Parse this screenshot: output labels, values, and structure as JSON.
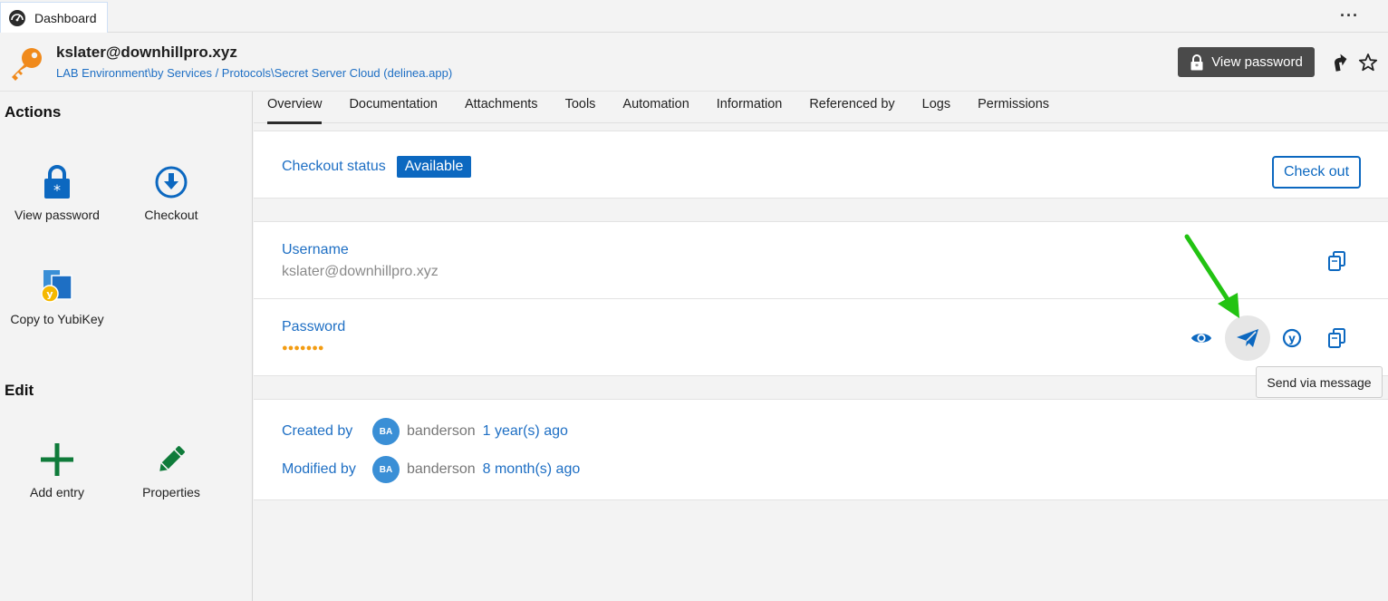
{
  "window": {
    "tab_label": "Dashboard",
    "more_icon": "more-horizontal-icon"
  },
  "header": {
    "title": "kslater@downhillpro.xyz",
    "path": "LAB Environment\\by Services / Protocols\\Secret Server Cloud (delinea.app)",
    "view_password_label": "View password",
    "key_color": "#f08a1c"
  },
  "sidebar": {
    "actions_title": "Actions",
    "edit_title": "Edit",
    "actions": [
      {
        "label": "View password",
        "icon": "lock-asterisk-icon"
      },
      {
        "label": "Checkout",
        "icon": "download-circle-icon"
      },
      {
        "label": "Copy to YubiKey",
        "icon": "yubikey-copy-icon"
      }
    ],
    "edit": [
      {
        "label": "Add entry",
        "icon": "plus-icon"
      },
      {
        "label": "Properties",
        "icon": "pencil-icon"
      }
    ]
  },
  "tabs": [
    "Overview",
    "Documentation",
    "Attachments",
    "Tools",
    "Automation",
    "Information",
    "Referenced by",
    "Logs",
    "Permissions"
  ],
  "active_tab": "Overview",
  "checkout": {
    "label": "Checkout status",
    "status": "Available",
    "button": "Check out"
  },
  "fields": {
    "username_label": "Username",
    "username_value": "kslater@downhillpro.xyz",
    "password_label": "Password",
    "password_mask": "●●●●●●●"
  },
  "tooltip": "Send via message",
  "meta": {
    "created_label": "Created by",
    "created_initials": "BA",
    "created_user": "banderson",
    "created_when": "1 year(s) ago",
    "modified_label": "Modified by",
    "modified_initials": "BA",
    "modified_user": "banderson",
    "modified_when": "8 month(s) ago"
  },
  "colors": {
    "accent": "#0c68c0",
    "link": "#1e6fc4",
    "annotation_arrow": "#22c312"
  }
}
